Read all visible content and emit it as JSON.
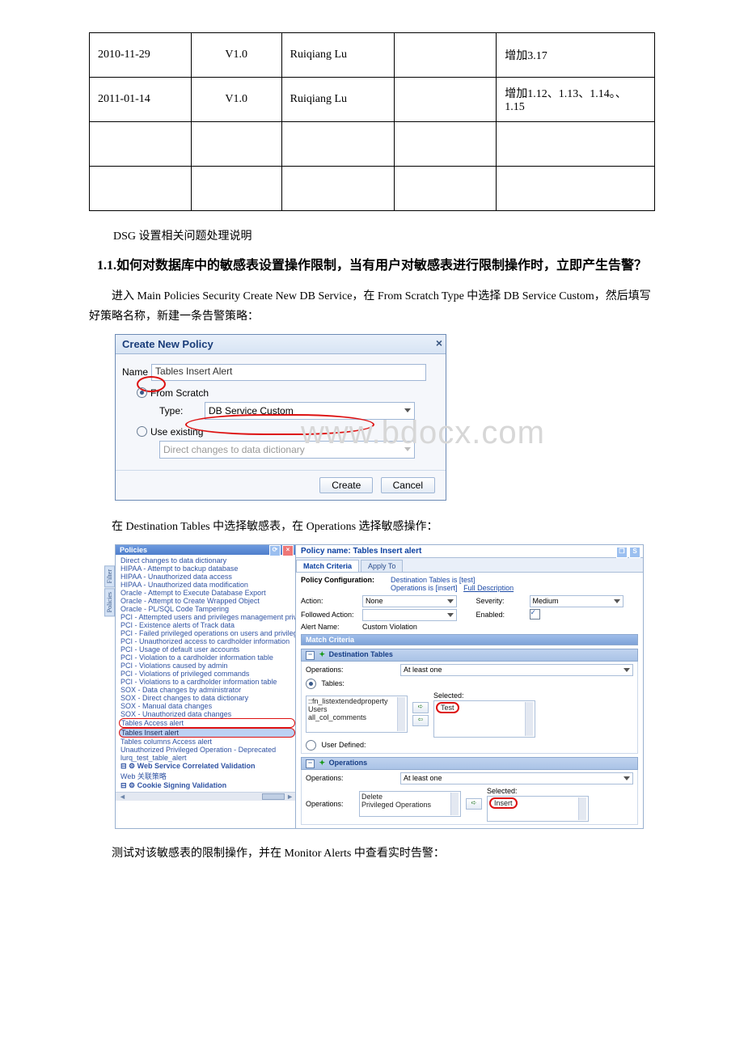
{
  "table": {
    "rows": [
      {
        "c1": "          2010-11-29",
        "c2": "V1.0",
        "c3": "          Ruiqiang Lu",
        "c4": "",
        "c5": "          增加3.17"
      },
      {
        "c1": "          2011-01-14",
        "c2": "V1.0",
        "c3": "          Ruiqiang Lu",
        "c4": "",
        "c5": "          增加1.12、1.13、1.14。、1.15"
      },
      {
        "c1": "",
        "c2": "",
        "c3": "",
        "c4": "",
        "c5": ""
      },
      {
        "c1": "",
        "c2": "",
        "c3": "",
        "c4": "",
        "c5": ""
      }
    ]
  },
  "intro": "DSG 设置相关问题处理说明",
  "heading": "1.1.如何对数据库中的敏感表设置操作限制，当有用户对敏感表进行限制操作时，立即产生告警？",
  "p1": "进入 Main Policies Security  Create New DB Service，在 From Scratch Type 中选择 DB Service Custom，然后填写好策略名称，新建一条告警策略：",
  "p2": "在 Destination Tables 中选择敏感表，在 Operations 选择敏感操作：",
  "p3": "测试对该敏感表的限制操作，并在 Monitor Alerts 中查看实时告警：",
  "watermark": "www.bdocx.com",
  "dlg": {
    "title": "Create New Policy",
    "name_label": "Name",
    "name_value": "Tables Insert Alert",
    "from_scratch": "From Scratch",
    "type_label": "Type:",
    "type_value": "DB Service Custom",
    "use_existing": "Use existing",
    "existing_value": "Direct changes to data dictionary",
    "create": "Create",
    "cancel": "Cancel"
  },
  "policies": {
    "tab_title": "Policies",
    "vtabs": [
      "Filter",
      "Policies"
    ],
    "items": [
      "Direct changes to data dictionary",
      "HIPAA - Attempt to backup database",
      "HIPAA - Unauthorized data access",
      "HIPAA - Unauthorized data modification",
      "Oracle - Attempt to Execute Database Export",
      "Oracle - Attempt to Create Wrapped Object",
      "Oracle - PL/SQL Code Tampering",
      "PCI - Attempted users and privileges management privileged ope",
      "PCI - Existence alerts of Track data",
      "PCI - Failed privileged operations on users and privileges manag",
      "PCI - Unauthorized access to cardholder information",
      "PCI - Usage of default user accounts",
      "PCI - Violation to a cardholder information table",
      "PCI - Violations caused by admin",
      "PCI - Violations of privileged commands",
      "PCI - Violations to a cardholder information table",
      "SOX - Data changes by administrator",
      "SOX - Direct changes to data dictionary",
      "SOX - Manual data changes",
      "SOX - Unauthorized data changes",
      "Tables Access alert",
      "Tables Insert alert",
      "Tables columns Access alert",
      "Unauthorized Privileged Operation - Deprecated",
      "lurq_test_table_alert",
      "Web Service Correlated Validation",
      "Web 关联策略",
      "Cookie Signing Validation"
    ],
    "selected_index": 21,
    "red_index": 20
  },
  "detail": {
    "policy_name_label": "Policy name:",
    "policy_name_value": "Tables Insert alert",
    "tab_match": "Match Criteria",
    "tab_apply": "Apply To",
    "policy_conf": "Policy Configuration:",
    "desc1": "Destination Tables is [test]",
    "desc2_a": "Operations is [insert]",
    "desc2_b": "Full Description",
    "action": "Action:",
    "action_v": "None",
    "severity": "Severity:",
    "severity_v": "Medium",
    "followed": "Followed Action:",
    "enabled": "Enabled:",
    "alert_name": "Alert Name:",
    "alert_name_v": "Custom Violation",
    "match_criteria": "Match Criteria",
    "dest_tables": "Destination Tables",
    "operations_lbl": "Operations:",
    "at_least": "At least one",
    "tables_radio": "Tables:",
    "user_def": "User Defined:",
    "selected": "Selected:",
    "tables_list": [
      "::fn_listextendedproperty",
      "Users",
      "all_col_comments"
    ],
    "selected_table": "Test",
    "ops_section": "Operations",
    "ops_list": [
      "Delete",
      "Privileged Operations"
    ],
    "selected_op": "Insert"
  }
}
